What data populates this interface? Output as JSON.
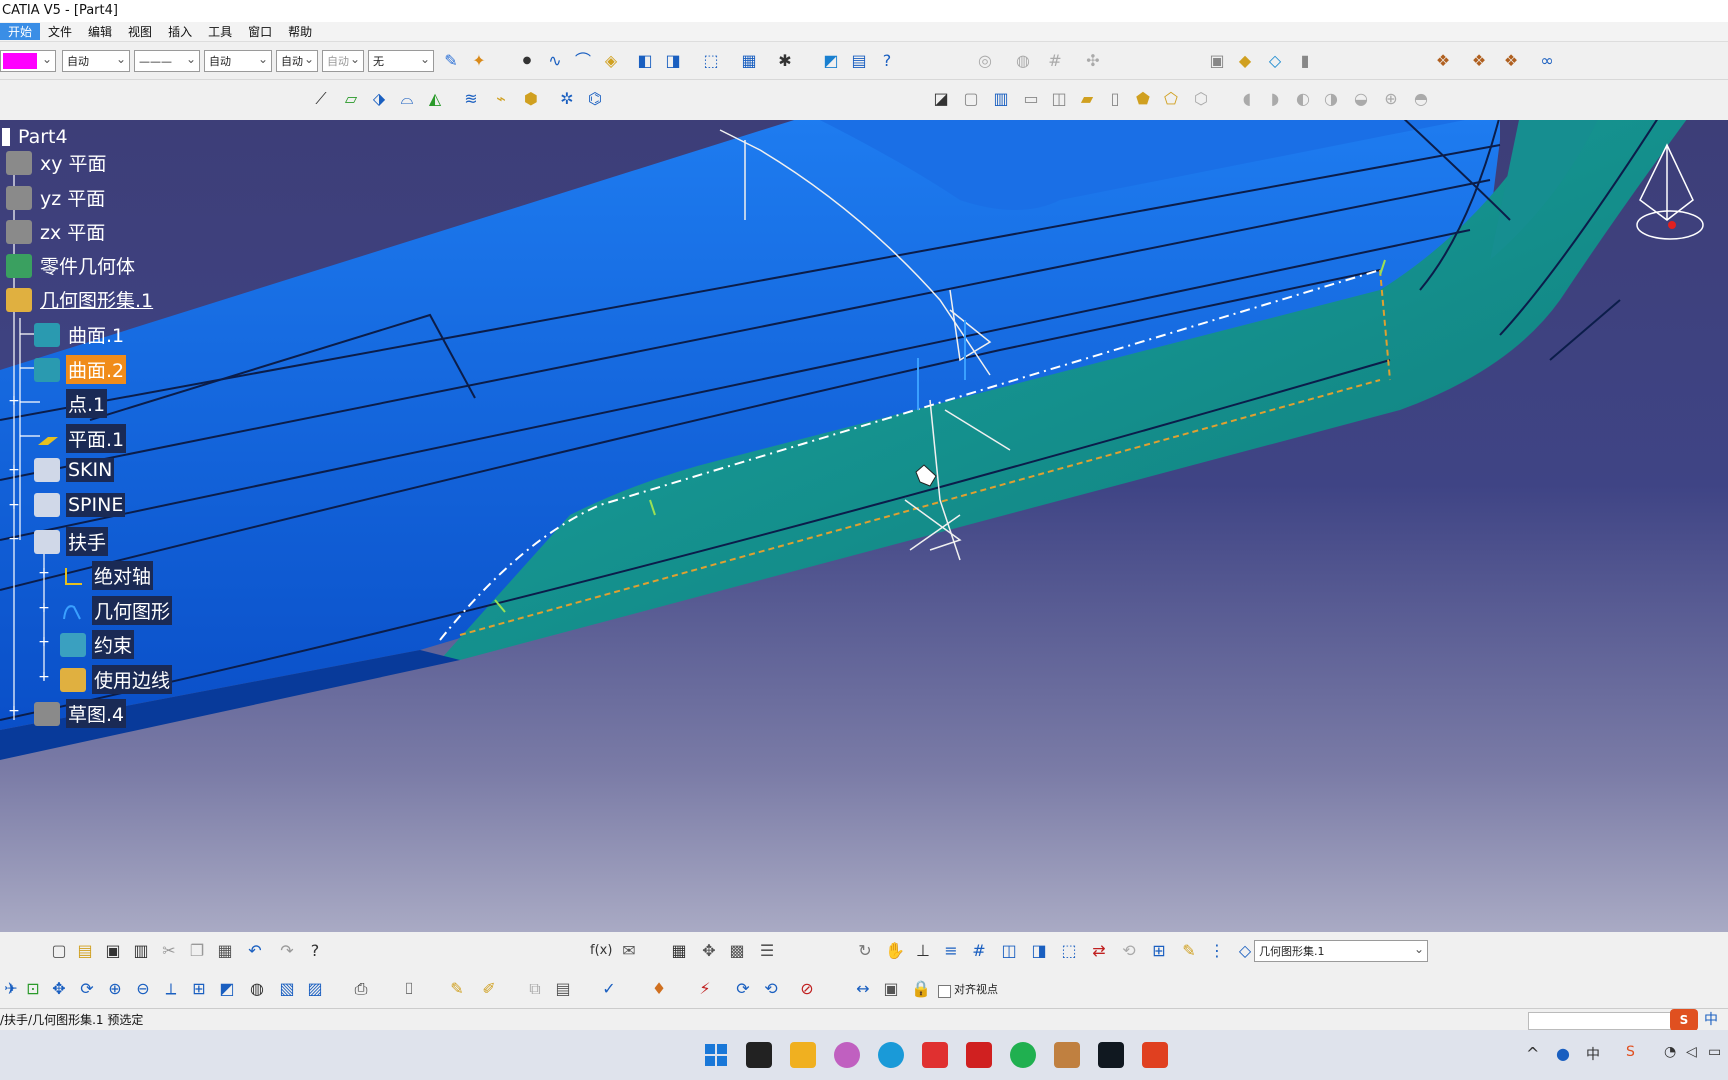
{
  "window": {
    "title": "CATIA V5 - [Part4]"
  },
  "menu": [
    {
      "label": "开始",
      "active": true
    },
    {
      "label": "文件"
    },
    {
      "label": "编辑"
    },
    {
      "label": "视图"
    },
    {
      "label": "插入"
    },
    {
      "label": "工具"
    },
    {
      "label": "窗口"
    },
    {
      "label": "帮助"
    }
  ],
  "properties": {
    "color": "#ff00ff",
    "transparency": "自动",
    "linetype": "———",
    "thickness": "自动",
    "point_type": "自动",
    "layer_disabled": "自动",
    "layer": "无"
  },
  "tree": {
    "root": "Part4",
    "items": [
      {
        "label": "xy 平面"
      },
      {
        "label": "yz 平面"
      },
      {
        "label": "zx 平面"
      },
      {
        "label": "零件几何体"
      },
      {
        "label": "几何图形集.1"
      },
      {
        "label": "曲面.1"
      },
      {
        "label": "曲面.2"
      },
      {
        "label": "点.1"
      },
      {
        "label": "平面.1"
      },
      {
        "label": "SKIN"
      },
      {
        "label": "SPINE"
      },
      {
        "label": "扶手"
      },
      {
        "label": "绝对轴"
      },
      {
        "label": "几何图形"
      },
      {
        "label": "约束"
      },
      {
        "label": "使用边线"
      },
      {
        "label": "草图.4"
      }
    ]
  },
  "colors": {
    "viewport_top": "#3d3e78",
    "surface_blue": "#0a5fd8",
    "surface_teal": "#128a8a",
    "tree_highlight": "#f08c1a"
  },
  "bottom": {
    "active_set": "几何图形集.1",
    "align_view_label": "对齐视点"
  },
  "status": {
    "text": "/扶手/几何图形集.1 预选定"
  },
  "taskbar": {
    "ime": "中"
  }
}
